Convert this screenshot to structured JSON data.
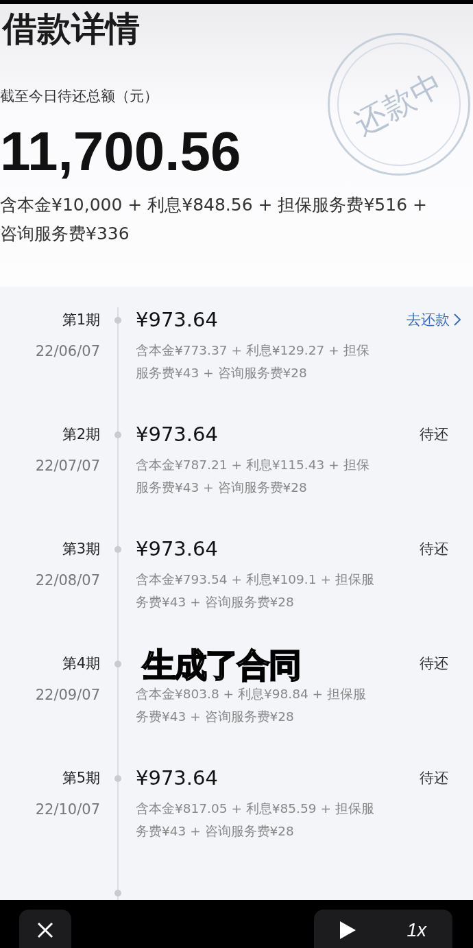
{
  "header": {
    "title": "借款详情",
    "subtitle": "截至今日待还总额（元）",
    "total": "11,700.56",
    "breakdown": "含本金¥10,000 + 利息¥848.56 + 担保服务费¥516 + 咨询服务费¥336",
    "stamp": "还款中"
  },
  "installments": [
    {
      "period": "第1期",
      "date": "22/06/07",
      "amount": "¥973.64",
      "breakdown": "含本金¥773.37 + 利息¥129.27 + 担保服务费¥43 + 咨询服务费¥28",
      "kind": "link",
      "action": "去还款"
    },
    {
      "period": "第2期",
      "date": "22/07/07",
      "amount": "¥973.64",
      "breakdown": "含本金¥787.21 + 利息¥115.43 + 担保服务费¥43 + 咨询服务费¥28",
      "kind": "status",
      "action": "待还"
    },
    {
      "period": "第3期",
      "date": "22/08/07",
      "amount": "¥973.64",
      "breakdown": "含本金¥793.54 + 利息¥109.1 + 担保服务费¥43 + 咨询服务费¥28",
      "kind": "status",
      "action": "待还"
    },
    {
      "period": "第4期",
      "date": "22/09/07",
      "breakdown": "含本金¥803.8 + 利息¥98.84 + 担保服务费¥43 + 咨询服务费¥28",
      "kind": "status",
      "action": "待还"
    },
    {
      "period": "第5期",
      "date": "22/10/07",
      "amount": "¥973.64",
      "breakdown": "含本金¥817.05 + 利息¥85.59 + 担保服务费¥43 + 咨询服务费¥28",
      "kind": "status",
      "action": "待还"
    }
  ],
  "caption": "生成了合同",
  "player": {
    "speed": "1x"
  }
}
